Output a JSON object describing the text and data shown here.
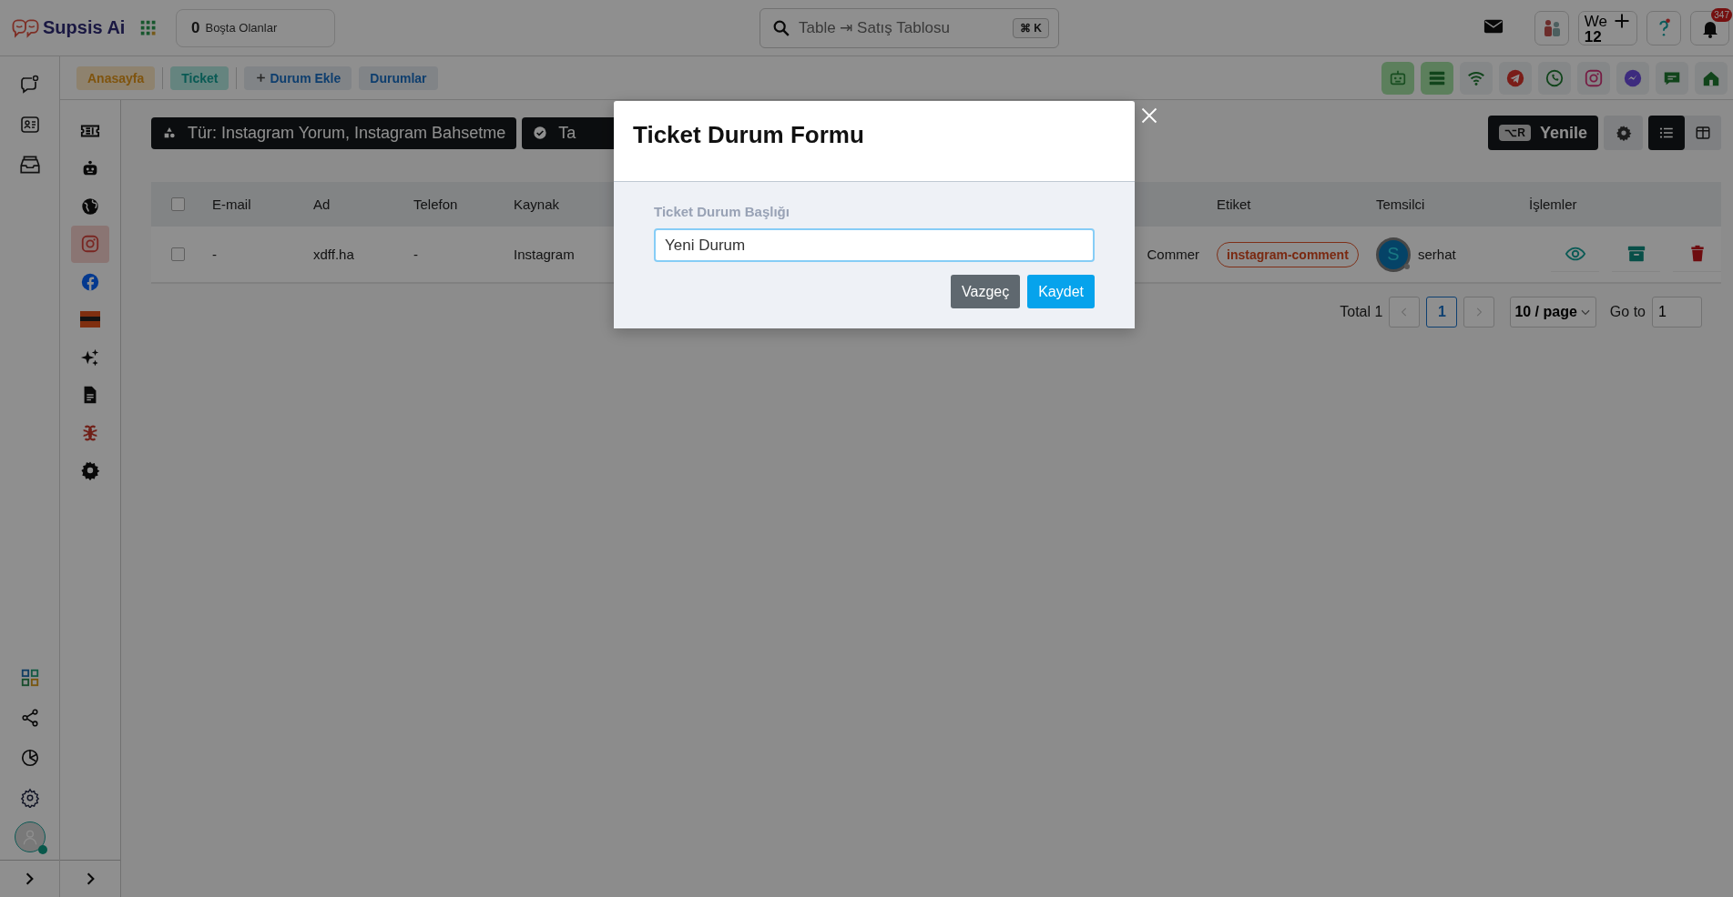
{
  "app": {
    "logo": "Supsis Ai"
  },
  "idle": {
    "count": "0",
    "label": "Boşta Olanlar"
  },
  "search": {
    "value": "Table ⇥ Satış Tablosu",
    "shortcut": "⌘ K"
  },
  "header_actions": {
    "we_label": "We",
    "we_count": "12",
    "notification_count": "347"
  },
  "rail": [
    {
      "kind": "chat",
      "selected": false
    },
    {
      "kind": "contacts",
      "selected": false
    },
    {
      "kind": "inbox",
      "selected": false
    }
  ],
  "rail_bottom": [
    {
      "kind": "apps"
    },
    {
      "kind": "share"
    },
    {
      "kind": "reports"
    },
    {
      "kind": "settings"
    }
  ],
  "breadcrumbs": [
    {
      "label": "Anasayfa",
      "kind": "home"
    },
    {
      "label": "Ticket",
      "kind": "current"
    },
    {
      "label": "Durum Ekle",
      "kind": "add"
    },
    {
      "label": "Durumlar",
      "kind": "link"
    }
  ],
  "channels": [
    {
      "kind": "bot",
      "active": true
    },
    {
      "kind": "list",
      "active": true
    },
    {
      "kind": "wifi",
      "active": false
    },
    {
      "kind": "telegram",
      "active": false
    },
    {
      "kind": "whatsapp",
      "active": false
    },
    {
      "kind": "instagram",
      "active": false
    },
    {
      "kind": "messenger",
      "active": false
    },
    {
      "kind": "sms",
      "active": false
    },
    {
      "kind": "home",
      "active": false
    }
  ],
  "sidebar": [
    {
      "kind": "ticket",
      "selected": false
    },
    {
      "kind": "bot",
      "selected": false
    },
    {
      "kind": "web",
      "selected": false
    },
    {
      "kind": "instagram",
      "selected": true
    },
    {
      "kind": "facebook",
      "selected": false
    },
    {
      "kind": "marketplace",
      "selected": false
    },
    {
      "kind": "ai",
      "selected": false
    },
    {
      "kind": "document",
      "selected": false
    },
    {
      "kind": "integration",
      "selected": false
    },
    {
      "kind": "settings",
      "selected": false
    }
  ],
  "filters": [
    {
      "label": "Tür: Instagram Yorum, Instagram Bahsetme",
      "kind": "type"
    },
    {
      "label": "Ta",
      "kind": "status"
    }
  ],
  "refresh": {
    "shortcut": "⌥R",
    "label": "Yenile"
  },
  "view_modes": [
    {
      "kind": "list",
      "selected": true
    },
    {
      "kind": "columns",
      "selected": false
    }
  ],
  "table": {
    "header_checked": false,
    "columns": [
      "E-mail",
      "Ad",
      "Telefon",
      "Kaynak",
      "Etiket",
      "Temsilci",
      "İşlemler"
    ],
    "rows": [
      {
        "checked": false,
        "email": "-",
        "name": "xdff.ha",
        "phone": "-",
        "source": "Instagram",
        "column_5": "Commer",
        "tag": "instagram-comment",
        "agent_initial": "S",
        "agent": "serhat"
      }
    ]
  },
  "pagination": {
    "total": "Total 1",
    "pages": [
      {
        "label": "1",
        "selected": true
      }
    ],
    "page_size": "10 / page",
    "goto_label": "Go to",
    "goto_value": "1"
  },
  "modal": {
    "title": "Ticket Durum Formu",
    "field_label": "Ticket Durum Başlığı",
    "field_value": "Yeni Durum",
    "buttons": [
      {
        "label": "Vazgeç",
        "kind": "cancel"
      },
      {
        "label": "Kaydet",
        "kind": "primary"
      }
    ]
  }
}
